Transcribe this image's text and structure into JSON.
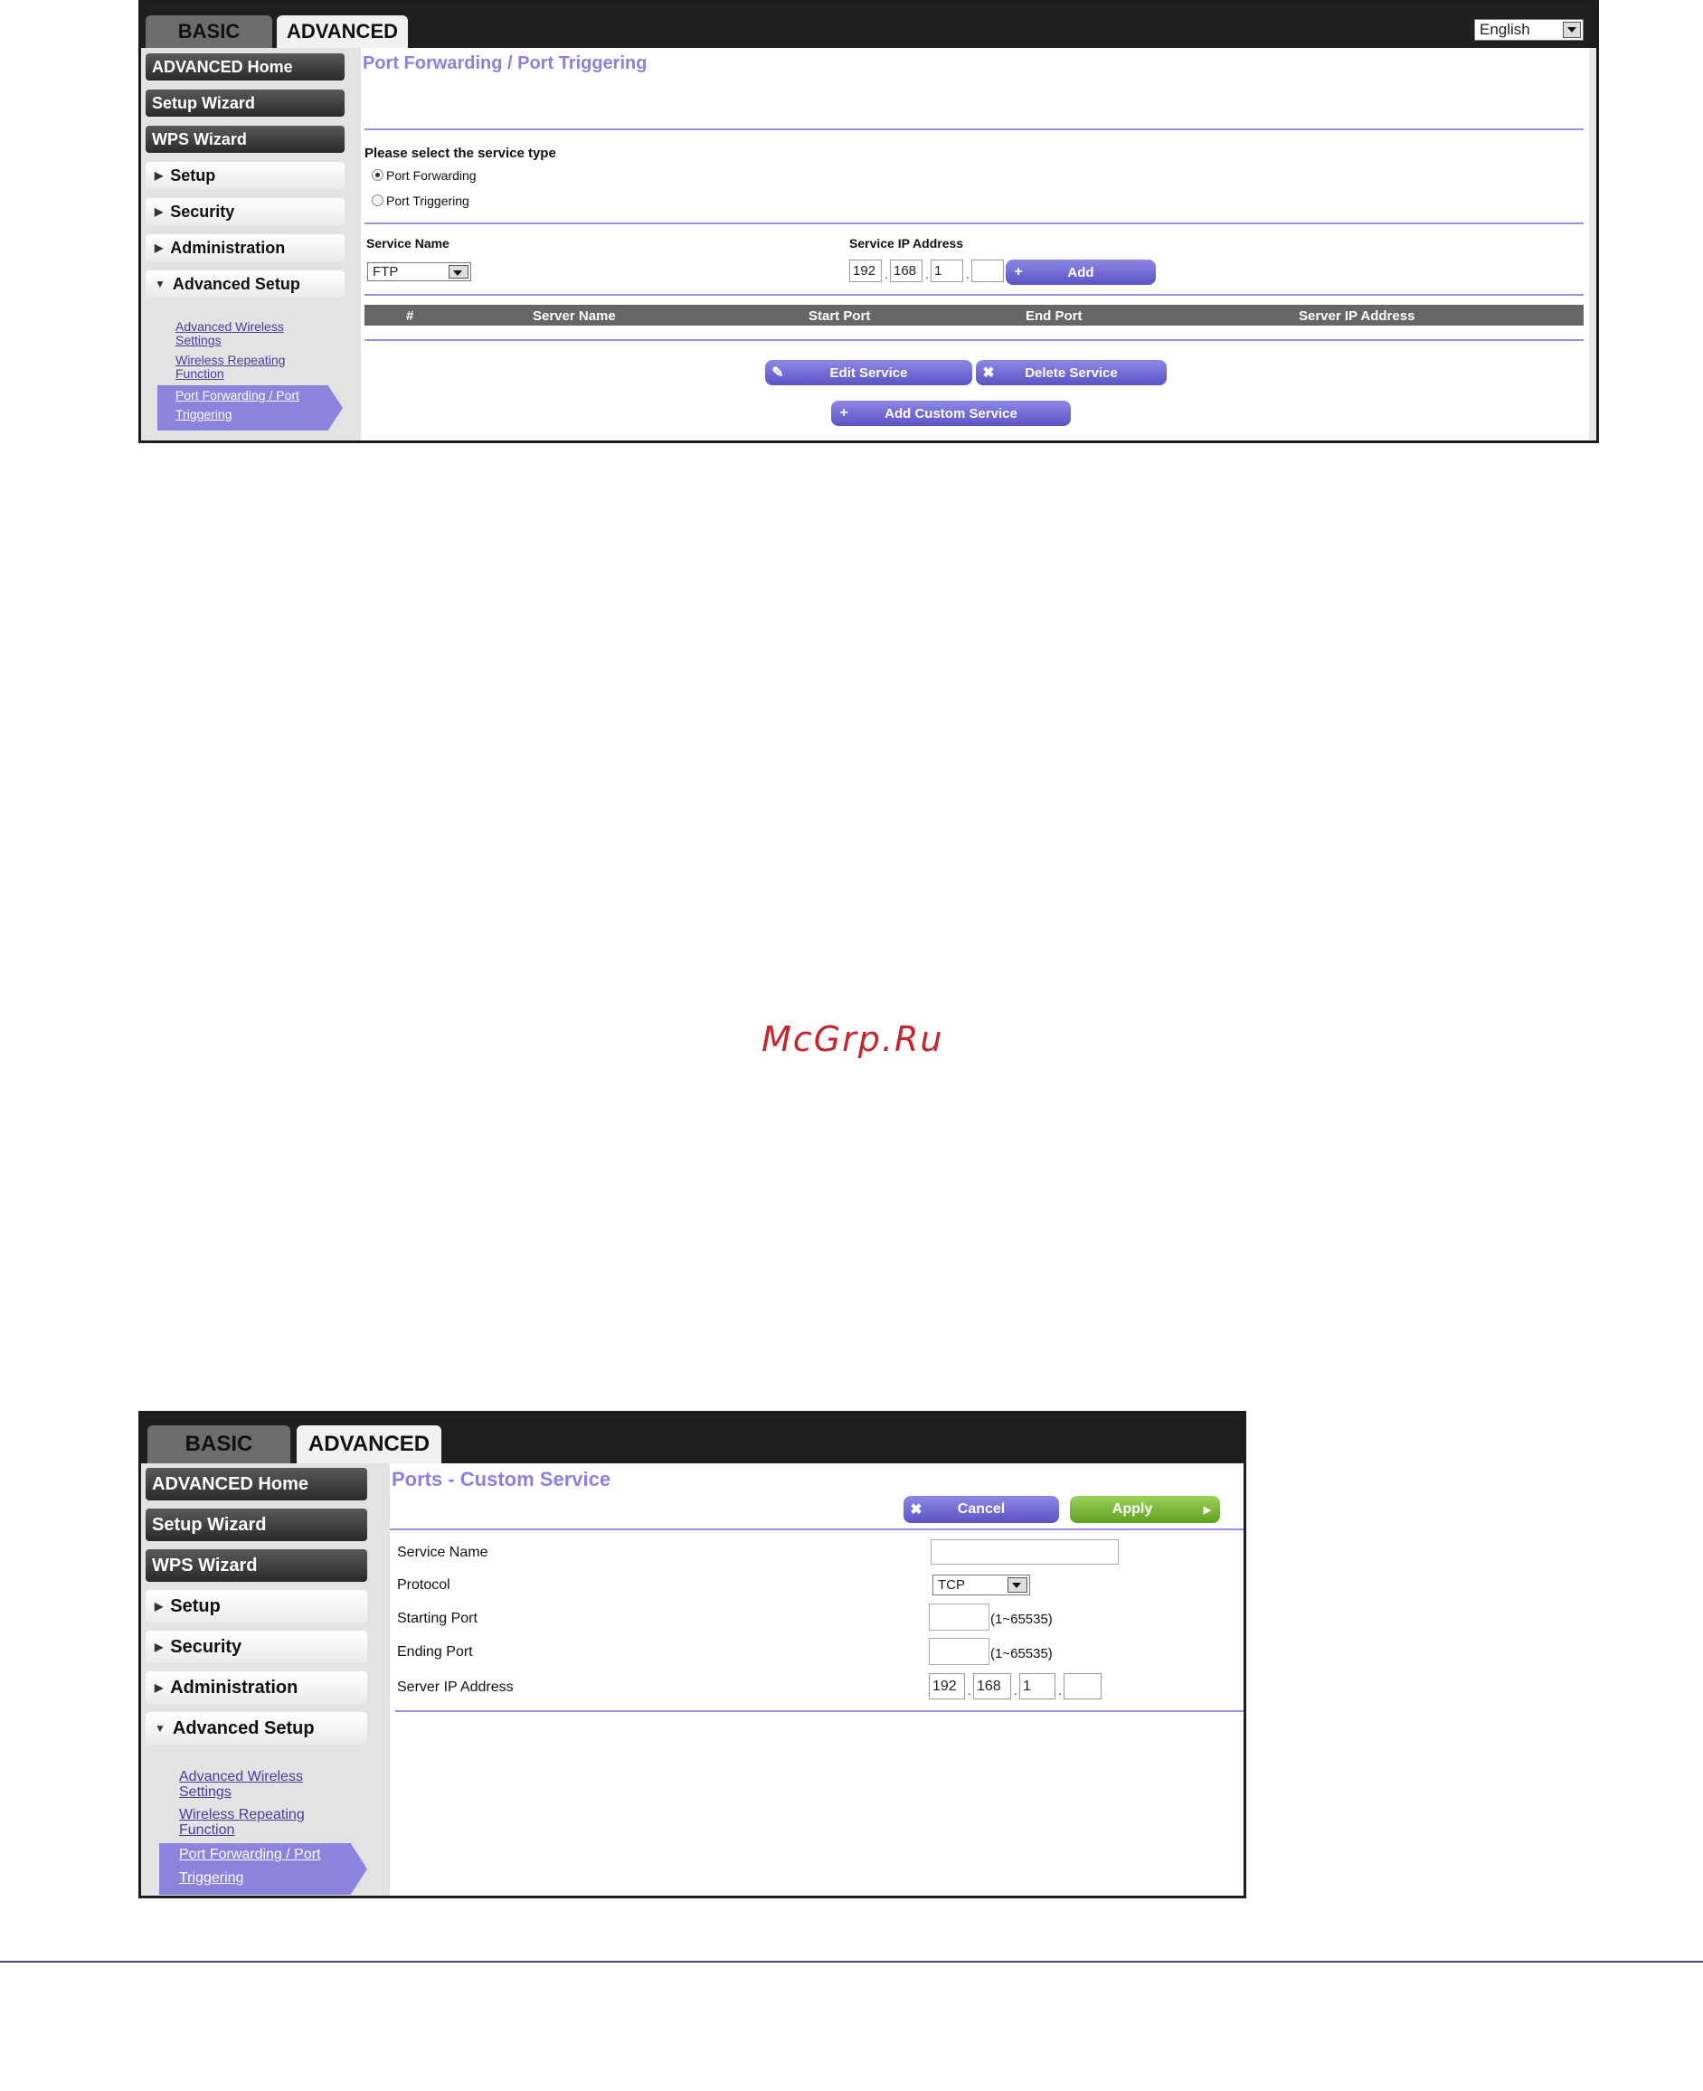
{
  "screen1": {
    "tabs": {
      "basic": "BASIC",
      "advanced": "ADVANCED"
    },
    "language": "English",
    "nav": {
      "advanced_home": "ADVANCED Home",
      "setup_wizard": "Setup Wizard",
      "wps_wizard": "WPS Wizard",
      "setup": "Setup",
      "security": "Security",
      "administration": "Administration",
      "advanced_setup": "Advanced Setup"
    },
    "sublinks": {
      "adv_wireless_1": "Advanced Wireless",
      "adv_wireless_2": "Settings",
      "wireless_rep_1": "Wireless Repeating",
      "wireless_rep_2": "Function",
      "pf_1": "Port Forwarding / Port",
      "pf_2": "Triggering"
    },
    "title": "Port Forwarding / Port Triggering",
    "service_type_label": "Please select the service type",
    "radio_forwarding": "Port Forwarding",
    "radio_triggering": "Port Triggering",
    "service_name_label": "Service Name",
    "service_name_value": "FTP",
    "service_ip_label": "Service IP Address",
    "ip": [
      "192",
      "168",
      "1",
      ""
    ],
    "add_button": "Add",
    "columns": [
      "#",
      "Server Name",
      "Start Port",
      "End Port",
      "Server IP Address"
    ],
    "edit_service": "Edit Service",
    "delete_service": "Delete Service",
    "add_custom_service": "Add Custom Service"
  },
  "watermark": "McGrp.Ru",
  "screen2": {
    "tabs": {
      "basic": "BASIC",
      "advanced": "ADVANCED"
    },
    "nav": {
      "advanced_home": "ADVANCED Home",
      "setup_wizard": "Setup Wizard",
      "wps_wizard": "WPS Wizard",
      "setup": "Setup",
      "security": "Security",
      "administration": "Administration",
      "advanced_setup": "Advanced Setup"
    },
    "sublinks": {
      "adv_wireless_1": "Advanced Wireless",
      "adv_wireless_2": "Settings",
      "wireless_rep_1": "Wireless Repeating",
      "wireless_rep_2": "Function",
      "pf_1": "Port Forwarding / Port",
      "pf_2": "Triggering"
    },
    "title": "Ports - Custom Service",
    "cancel": "Cancel",
    "apply": "Apply",
    "service_name_label": "Service Name",
    "service_name_value": "",
    "protocol_label": "Protocol",
    "protocol_value": "TCP",
    "starting_port_label": "Starting Port",
    "starting_port_value": "",
    "starting_port_range": "(1~65535)",
    "ending_port_label": "Ending Port",
    "ending_port_value": "",
    "ending_port_range": "(1~65535)",
    "server_ip_label": "Server IP Address",
    "ip": [
      "192",
      "168",
      "1",
      ""
    ]
  },
  "colors": {
    "accent": "#8d80e0",
    "divider": "#9b8fe2",
    "apply_green": "#6fb02f",
    "watermark": "#c2272d",
    "footer_line": "#4a3f98"
  }
}
